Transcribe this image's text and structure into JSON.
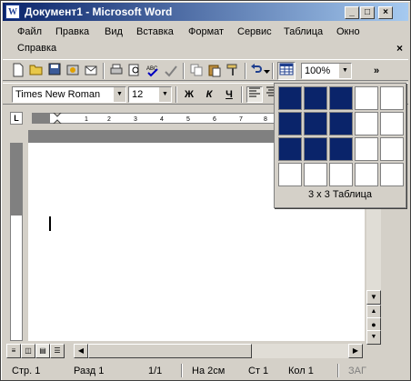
{
  "window": {
    "title": "Документ1 - Microsoft Word",
    "app_icon": "W"
  },
  "title_buttons": {
    "minimize": "_",
    "maximize": "□",
    "close": "×"
  },
  "menu": {
    "items": [
      {
        "key": "file",
        "label": "Файл",
        "mnemonic": "Ф"
      },
      {
        "key": "edit",
        "label": "Правка",
        "mnemonic": "П"
      },
      {
        "key": "view",
        "label": "Вид",
        "mnemonic": "В"
      },
      {
        "key": "insert",
        "label": "Вставка",
        "mnemonic": "с"
      },
      {
        "key": "format",
        "label": "Формат",
        "mnemonic": "о"
      },
      {
        "key": "tools",
        "label": "Сервис",
        "mnemonic": "С"
      },
      {
        "key": "table",
        "label": "Таблица",
        "mnemonic": "Т"
      },
      {
        "key": "window",
        "label": "Окно",
        "mnemonic": "О"
      },
      {
        "key": "help",
        "label": "Справка",
        "mnemonic": "С"
      }
    ],
    "close_glyph": "×"
  },
  "standard_toolbar": {
    "zoom": "100%",
    "more": "»"
  },
  "format_toolbar": {
    "font": "Times New Roman",
    "size": "12",
    "bold": "Ж",
    "italic": "К",
    "underline": "Ч"
  },
  "table_picker": {
    "label": "3 x 3 Таблица",
    "rows_selected": 3,
    "cols_selected": 3,
    "grid_rows": 4,
    "grid_cols": 5
  },
  "status": {
    "page": "Стр. 1",
    "section": "Разд 1",
    "pages": "1/1",
    "position": "На 2см",
    "line": "Ст 1",
    "column": "Кол 1",
    "mode": "ЗАГ"
  }
}
